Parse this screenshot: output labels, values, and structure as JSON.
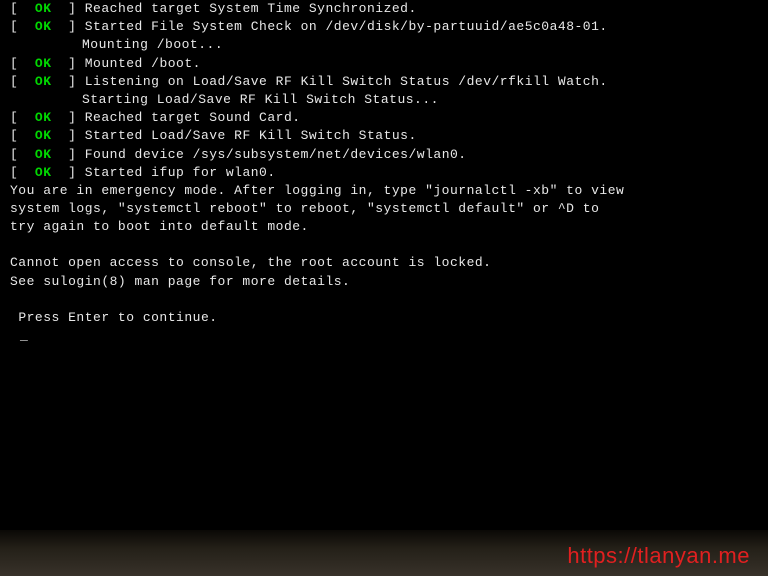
{
  "boot_lines": [
    {
      "type": "ok",
      "text": "Reached target System Time Synchronized."
    },
    {
      "type": "ok",
      "text": "Started File System Check on /dev/disk/by-partuuid/ae5c0a48-01."
    },
    {
      "type": "indent",
      "text": "Mounting /boot..."
    },
    {
      "type": "ok",
      "text": "Mounted /boot."
    },
    {
      "type": "ok",
      "text": "Listening on Load/Save RF Kill Switch Status /dev/rfkill Watch."
    },
    {
      "type": "indent",
      "text": "Starting Load/Save RF Kill Switch Status..."
    },
    {
      "type": "ok",
      "text": "Reached target Sound Card."
    },
    {
      "type": "ok",
      "text": "Started Load/Save RF Kill Switch Status."
    },
    {
      "type": "ok",
      "text": "Found device /sys/subsystem/net/devices/wlan0."
    },
    {
      "type": "ok",
      "text": "Started ifup for wlan0."
    }
  ],
  "emergency_message": "You are in emergency mode. After logging in, type \"journalctl -xb\" to view\nsystem logs, \"systemctl reboot\" to reboot, \"systemctl default\" or ^D to\ntry again to boot into default mode.",
  "console_error": "Cannot open access to console, the root account is locked.\nSee sulogin(8) man page for more details.",
  "prompt": " Press Enter to continue.",
  "cursor_char": "_",
  "ok_label": "OK",
  "bracket_open": "[  ",
  "bracket_close": "  ] ",
  "watermark_text": "https://tlanyan.me"
}
